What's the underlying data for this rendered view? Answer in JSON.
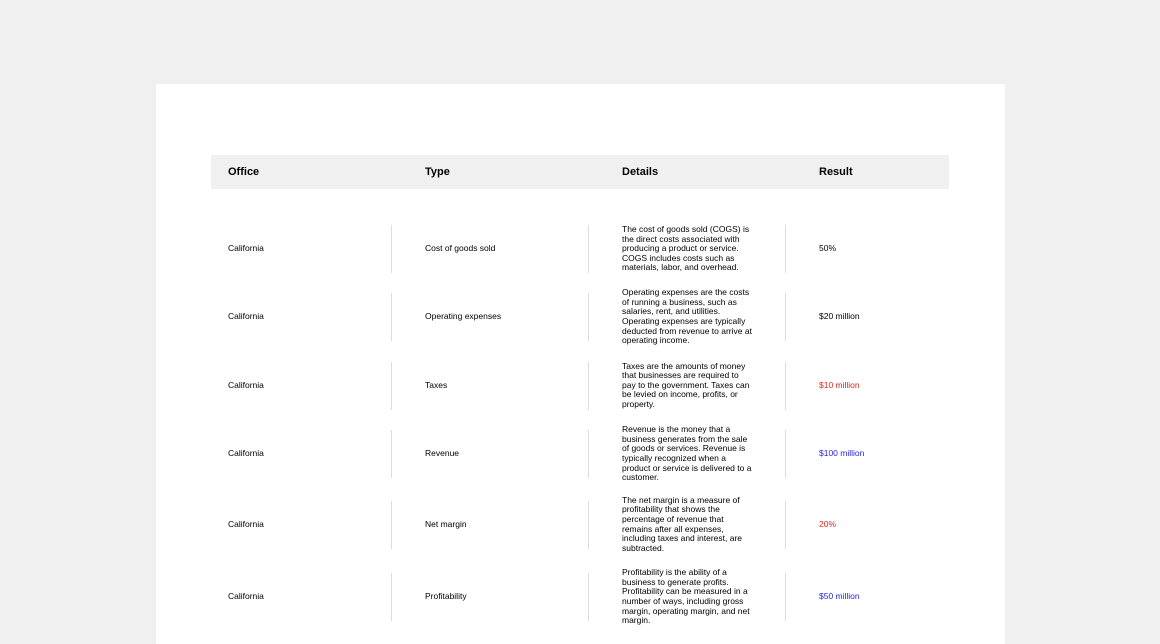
{
  "table": {
    "headers": [
      "Office",
      "Type",
      "Details",
      "Result"
    ],
    "rows": [
      {
        "office": "California",
        "type": "Cost of goods sold",
        "details": "The cost of goods sold (COGS) is the direct costs associated with producing a product or service. COGS includes costs such as materials, labor, and overhead.",
        "result": "50%"
      },
      {
        "office": "California",
        "type": "Operating expenses",
        "details": "Operating expenses are the costs of running a business, such as salaries, rent, and utilities. Operating expenses are typically deducted from revenue to arrive at operating income.",
        "result": "$20 million"
      },
      {
        "office": "California",
        "type": "Taxes",
        "details": "Taxes are the amounts of money that businesses are required to pay to the government. Taxes can be levied on income, profits, or property.",
        "result": "$10 million"
      },
      {
        "office": "California",
        "type": "Revenue",
        "details": "Revenue is the money that a business generates from the sale of goods or services. Revenue is typically recognized when a product or service is delivered to a customer.",
        "result": "$100 million"
      },
      {
        "office": "California",
        "type": "Net margin",
        "details": "The net margin is a measure of profitability that shows the percentage of revenue that remains after all expenses, including taxes and interest, are subtracted.",
        "result": "20%"
      },
      {
        "office": "California",
        "type": "Profitability",
        "details": "Profitability is the ability of a business to generate profits. Profitability can be measured in a number of ways, including gross margin, operating margin, and net margin.",
        "result": "$50 million"
      }
    ]
  },
  "colors": {
    "red": "#e0241c",
    "blue": "#2424e0"
  }
}
